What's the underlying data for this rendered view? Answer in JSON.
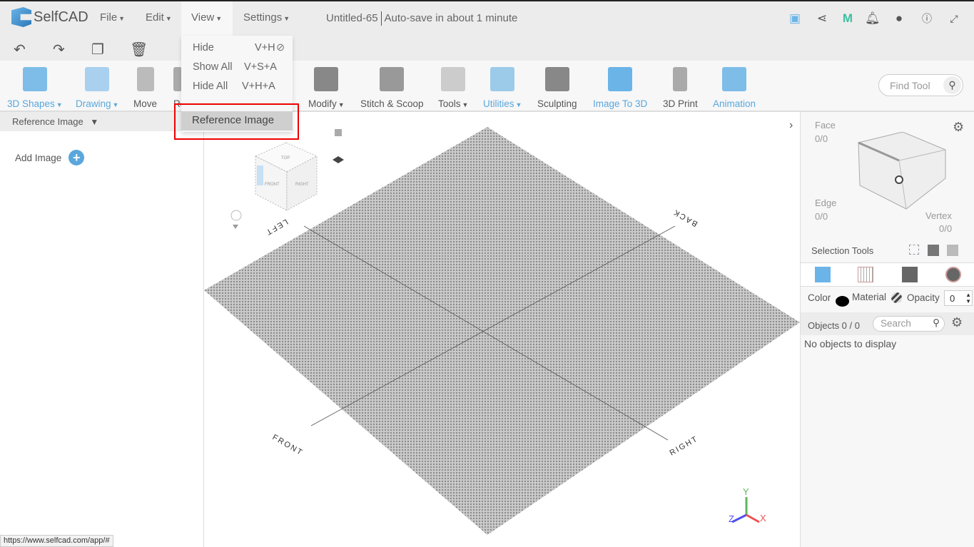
{
  "app": {
    "logo": "SelfCAD",
    "title": "Untitled-65",
    "autosave": "Auto-save in about 1 minute"
  },
  "menu": [
    {
      "label": "File"
    },
    {
      "label": "Edit"
    },
    {
      "label": "View"
    },
    {
      "label": "Settings"
    }
  ],
  "top_icons": [
    "save-icon",
    "share-icon",
    "m-logo-icon",
    "bell-icon",
    "user-icon",
    "info-icon",
    "fullscreen-icon"
  ],
  "edit_icons": [
    "undo-icon",
    "redo-icon",
    "copy-icon",
    "delete-icon"
  ],
  "tools": [
    {
      "label": "3D Shapes",
      "dropdown": true,
      "color": "#5aa7dc"
    },
    {
      "label": "Drawing",
      "dropdown": true,
      "color": "#5aa7dc"
    },
    {
      "label": "Move"
    },
    {
      "label": "Ro"
    },
    {
      "label": "Modify",
      "dropdown": true
    },
    {
      "label": "Stitch & Scoop"
    },
    {
      "label": "Tools",
      "dropdown": true
    },
    {
      "label": "Utilities",
      "dropdown": true,
      "color": "#5aa7dc"
    },
    {
      "label": "Sculpting"
    },
    {
      "label": "Image To 3D",
      "color": "#5aa7dc"
    },
    {
      "label": "3D Print"
    },
    {
      "label": "Animation",
      "color": "#5aa7dc"
    }
  ],
  "find_tool": {
    "placeholder": "Find Tool"
  },
  "view_menu": {
    "items": [
      {
        "label": "Hide",
        "shortcut": "V+H"
      },
      {
        "label": "Show All",
        "shortcut": "V+S+A"
      },
      {
        "label": "Hide All",
        "shortcut": "V+H+A"
      }
    ],
    "highlighted": "Reference Image"
  },
  "left_panel": {
    "header": "Reference Image",
    "add_image": "Add Image"
  },
  "viewport": {
    "labels": {
      "left": "LEFT",
      "back": "BACK",
      "front": "FRONT",
      "right": "RIGHT"
    },
    "cube": {
      "top": "TOP",
      "front": "FRONT",
      "right": "RIGHT"
    },
    "axes": {
      "x": "X",
      "y": "Y",
      "z": "Z",
      "x_color": "#f05050",
      "y_color": "#5cb85c",
      "z_color": "#5050f0"
    }
  },
  "right_panel": {
    "face": {
      "label": "Face",
      "value": "0/0"
    },
    "edge": {
      "label": "Edge",
      "value": "0/0"
    },
    "vertex": {
      "label": "Vertex",
      "value": "0/0"
    },
    "selection_tools": "Selection Tools",
    "color_label": "Color",
    "material_label": "Material",
    "opacity_label": "Opacity",
    "opacity_value": "0",
    "objects_label": "Objects 0 / 0",
    "search_placeholder": "Search",
    "empty": "No objects to display"
  },
  "status_url": "https://www.selfcad.com/app/#"
}
